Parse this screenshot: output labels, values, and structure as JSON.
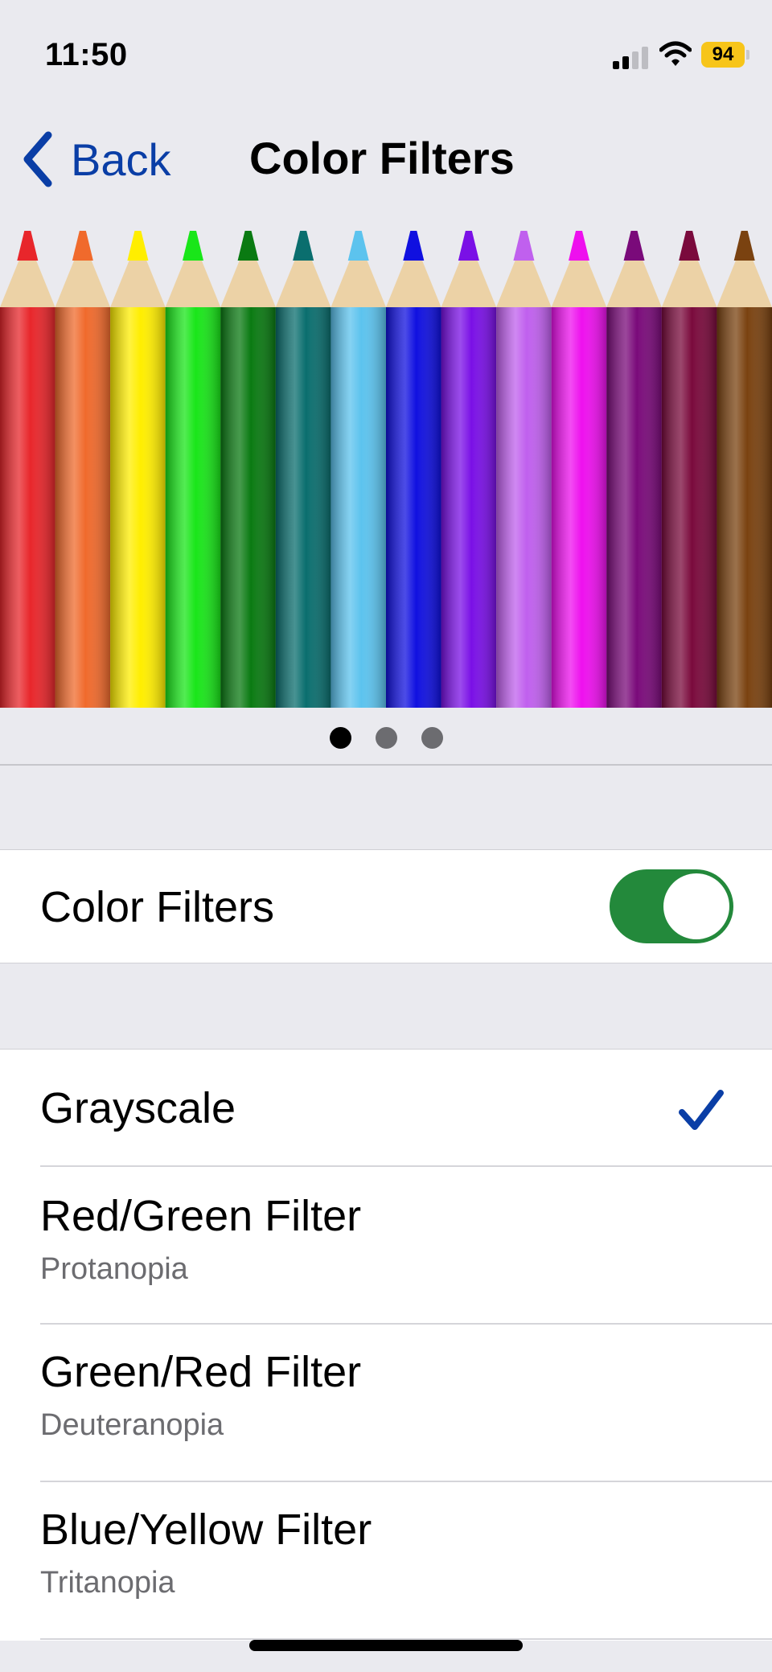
{
  "status_bar": {
    "time": "11:50",
    "battery_percent": "94",
    "battery_color": "#f7c51a"
  },
  "nav": {
    "back_label": "Back",
    "title": "Color Filters"
  },
  "preview": {
    "pencil_colors": [
      "#e8262b",
      "#f06a2c",
      "#ffee00",
      "#19e619",
      "#0a7a12",
      "#0a6e6e",
      "#5cc3ee",
      "#1010e0",
      "#7a10e6",
      "#c060ee",
      "#ee10ee",
      "#7a0a7a",
      "#7a0a3c",
      "#7a4210"
    ],
    "page_count": 3,
    "current_page": 1
  },
  "color_filters_toggle": {
    "label": "Color Filters",
    "on": true,
    "accent": "#23893b"
  },
  "filters": [
    {
      "label": "Grayscale",
      "sub": "",
      "selected": true
    },
    {
      "label": "Red/Green Filter",
      "sub": "Protanopia",
      "selected": false
    },
    {
      "label": "Green/Red Filter",
      "sub": "Deuteranopia",
      "selected": false
    },
    {
      "label": "Blue/Yellow Filter",
      "sub": "Tritanopia",
      "selected": false
    }
  ]
}
